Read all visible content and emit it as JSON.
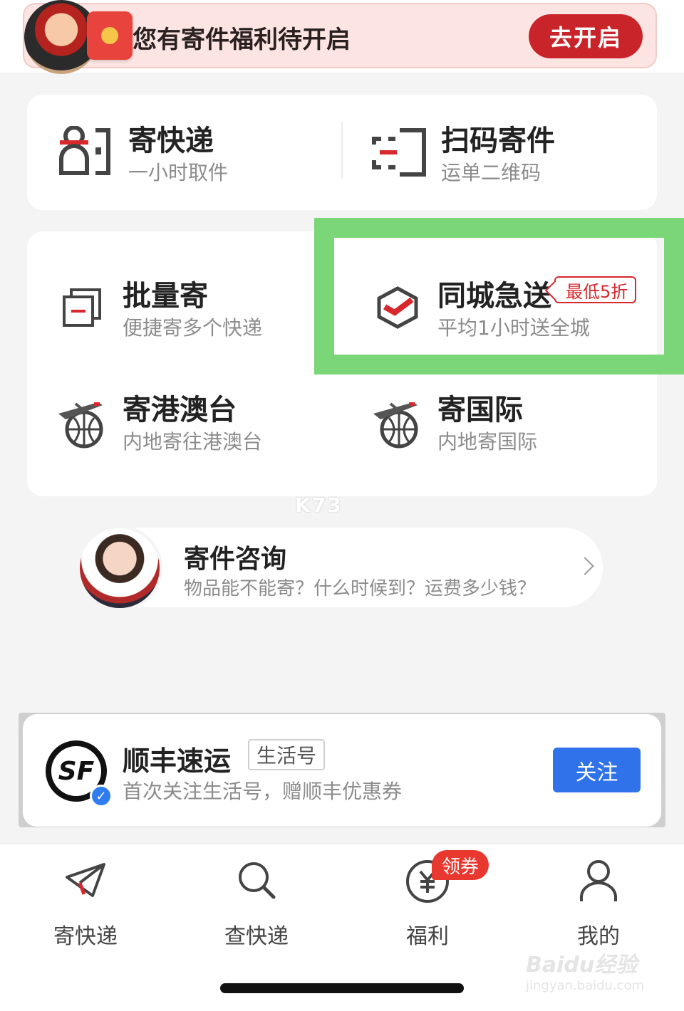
{
  "promo": {
    "text": "您有寄件福利待开启",
    "button": "去开启"
  },
  "services_top": [
    {
      "title": "寄快递",
      "subtitle": "一小时取件",
      "icon": "courier-icon"
    },
    {
      "title": "扫码寄件",
      "subtitle": "运单二维码",
      "icon": "scan-icon"
    }
  ],
  "services_grid": [
    {
      "title": "批量寄",
      "subtitle": "便捷寄多个快递",
      "icon": "batch-icon"
    },
    {
      "title": "同城急送",
      "subtitle": "平均1小时送全城",
      "icon": "box-check-icon",
      "tag": "最低5折"
    },
    {
      "title": "寄港澳台",
      "subtitle": "内地寄往港澳台",
      "icon": "globe-plane-icon"
    },
    {
      "title": "寄国际",
      "subtitle": "内地寄国际",
      "icon": "globe-plane-icon"
    }
  ],
  "watermark": "K73",
  "consult": {
    "title": "寄件咨询",
    "subtitle": "物品能不能寄？什么时候到？运费多少钱？"
  },
  "follow": {
    "name": "顺丰速运",
    "badge": "生活号",
    "desc": "首次关注生活号，赠顺丰优惠券",
    "button": "关注",
    "logo_text": "SF"
  },
  "tabbar": {
    "items": [
      {
        "label": "寄快递",
        "icon": "paper-plane-icon"
      },
      {
        "label": "查快递",
        "icon": "search-icon"
      },
      {
        "label": "福利",
        "icon": "yuan-coin-icon",
        "badge": "领券"
      },
      {
        "label": "我的",
        "icon": "user-icon"
      }
    ]
  },
  "baidu_watermark": "Baidu经验",
  "baidu_url": "jingyan.baidu.com",
  "colors": {
    "brand_red": "#c8242a",
    "highlight_green": "#7ad677",
    "follow_blue": "#2f72ea"
  }
}
